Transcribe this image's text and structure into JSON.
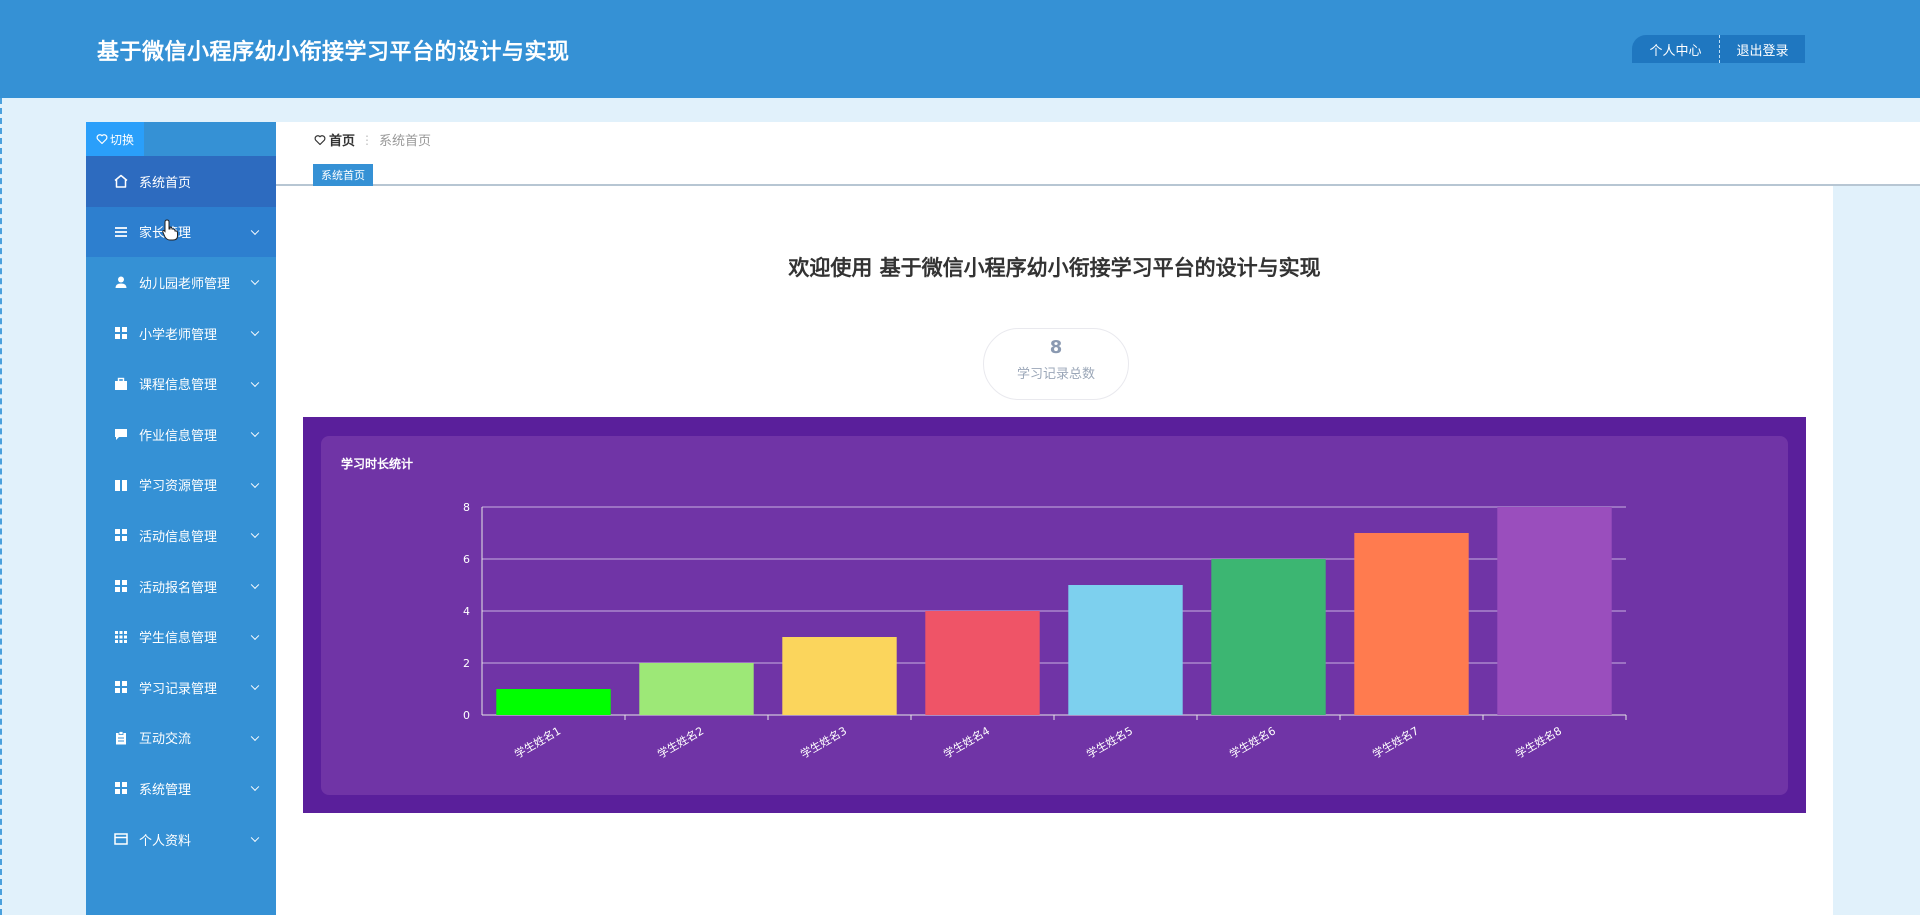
{
  "header": {
    "title": "基于微信小程序幼小衔接学习平台的设计与实现",
    "nav": [
      "个人中心",
      "退出登录"
    ]
  },
  "sidebar": {
    "switch_label": "切换",
    "items": [
      {
        "label": "系统首页",
        "icon": "home-icon"
      },
      {
        "label": "家长管理",
        "icon": "list-icon"
      },
      {
        "label": "幼儿园老师管理",
        "icon": "user-icon"
      },
      {
        "label": "小学老师管理",
        "icon": "grid-icon"
      },
      {
        "label": "课程信息管理",
        "icon": "briefcase-icon"
      },
      {
        "label": "作业信息管理",
        "icon": "comment-icon"
      },
      {
        "label": "学习资源管理",
        "icon": "book-icon"
      },
      {
        "label": "活动信息管理",
        "icon": "grid-icon"
      },
      {
        "label": "活动报名管理",
        "icon": "grid-icon"
      },
      {
        "label": "学生信息管理",
        "icon": "grid-nine-icon"
      },
      {
        "label": "学习记录管理",
        "icon": "grid-icon"
      },
      {
        "label": "互动交流",
        "icon": "clipboard-icon"
      },
      {
        "label": "系统管理",
        "icon": "grid-icon"
      },
      {
        "label": "个人资料",
        "icon": "card-icon"
      }
    ]
  },
  "breadcrumb": {
    "home": "首页",
    "separator": "⋮",
    "current": "系统首页"
  },
  "tab_tag": "系统首页",
  "welcome": "欢迎使用 基于微信小程序幼小衔接学习平台的设计与实现",
  "stat": {
    "value": "8",
    "label": "学习记录总数"
  },
  "chart_data": {
    "type": "bar",
    "title": "学习时长统计",
    "categories": [
      "学生姓名1",
      "学生姓名2",
      "学生姓名3",
      "学生姓名4",
      "学生姓名5",
      "学生姓名6",
      "学生姓名7",
      "学生姓名8"
    ],
    "values": [
      1,
      2,
      3,
      4,
      5,
      6,
      7,
      8
    ],
    "colors": [
      "#00ff00",
      "#9de877",
      "#fbd55c",
      "#ef5467",
      "#7dd0ee",
      "#3cb672",
      "#ff7b4f",
      "#9a4ebd"
    ],
    "ylim": [
      0,
      8
    ],
    "yticks": [
      0,
      2,
      4,
      6,
      8
    ],
    "grid": true,
    "xlabel": "",
    "ylabel": ""
  }
}
